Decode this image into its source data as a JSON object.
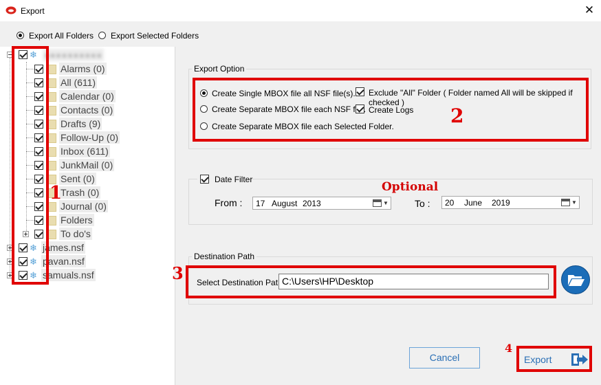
{
  "window": {
    "title": "Export",
    "close_glyph": "✕"
  },
  "mode": {
    "options": [
      {
        "label": "Export All Folders",
        "selected": true
      },
      {
        "label": "Export Selected Folders",
        "selected": false
      }
    ]
  },
  "tree": {
    "root": {
      "label": "●●●●●●●●●●",
      "checked": true,
      "icon": "database-icon"
    },
    "folders": [
      {
        "label": "Alarms (0)"
      },
      {
        "label": "All (611)"
      },
      {
        "label": "Calendar (0)"
      },
      {
        "label": "Contacts (0)"
      },
      {
        "label": "Drafts (9)"
      },
      {
        "label": "Follow-Up (0)"
      },
      {
        "label": "Inbox (611)"
      },
      {
        "label": "JunkMail (0)"
      },
      {
        "label": "Sent (0)"
      },
      {
        "label": "Trash (0)"
      },
      {
        "label": "Journal (0)"
      },
      {
        "label": "Folders"
      },
      {
        "label": "To do's"
      }
    ],
    "nsf_files": [
      {
        "label": "james.nsf"
      },
      {
        "label": "pavan.nsf"
      },
      {
        "label": "samuals.nsf"
      }
    ]
  },
  "export_option": {
    "group_title": "Export Option",
    "radios": [
      {
        "label": "Create Single MBOX file all NSF file(s).",
        "selected": true
      },
      {
        "label": "Create Separate MBOX file each NSF file.",
        "selected": false
      },
      {
        "label": "Create Separate MBOX file each Selected Folder.",
        "selected": false
      }
    ],
    "checkboxes": [
      {
        "label": "Exclude \"All\" Folder ( Folder named All will be skipped if checked )",
        "checked": true
      },
      {
        "label": "Create Logs",
        "checked": true
      }
    ]
  },
  "date_filter": {
    "label": "Date Filter",
    "checked": true,
    "optional_text": "Optional",
    "from_label": "From :",
    "to_label": "To :",
    "from": {
      "day": "17",
      "month": "August",
      "year": "2013"
    },
    "to": {
      "day": "20",
      "month": "June",
      "year": "2019"
    }
  },
  "destination": {
    "group_title": "Destination Path",
    "label": "Select Destination Path",
    "value": "C:\\Users\\HP\\Desktop"
  },
  "buttons": {
    "cancel": "Cancel",
    "export": "Export"
  },
  "annotations": {
    "n1": "1",
    "n2": "2",
    "n3": "3",
    "n4": "4"
  },
  "colors": {
    "annotation_red": "#e00000",
    "link_blue": "#2a6fb5",
    "folder_button": "#1b6db8"
  }
}
